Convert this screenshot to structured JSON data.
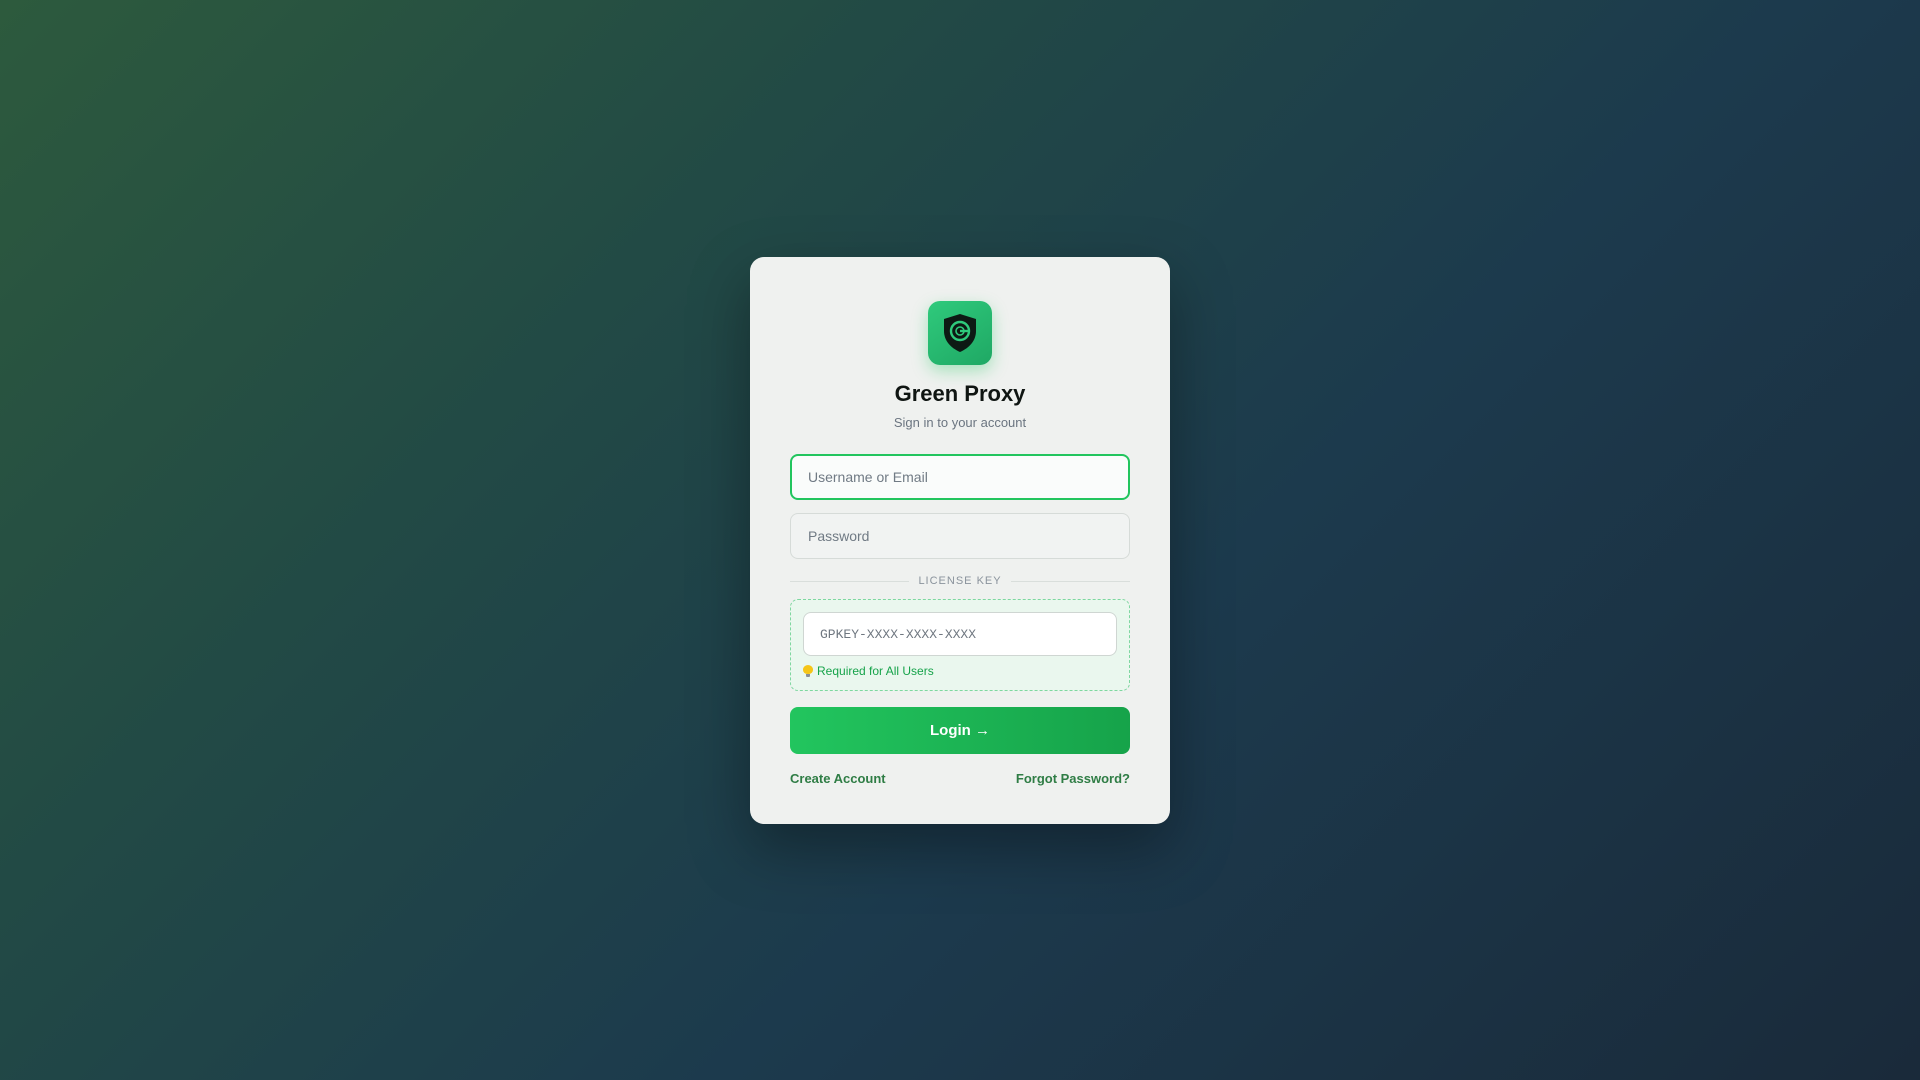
{
  "app": {
    "name": "Green Proxy",
    "subtitle": "Sign in to your account",
    "logo_icon": "shield-g-icon"
  },
  "form": {
    "username_placeholder": "Username or Email",
    "username_value": "",
    "password_placeholder": "Password",
    "password_value": "",
    "license_divider_label": "LICENSE KEY",
    "license_placeholder": "GPKEY-XXXX-XXXX-XXXX",
    "license_value": "",
    "license_note": "Required for All Users",
    "license_note_icon": "lightbulb-icon",
    "login_label": "Login →"
  },
  "links": {
    "create_account": "Create Account",
    "forgot_password": "Forgot Password?"
  },
  "colors": {
    "accent": "#22c55e",
    "accent_dark": "#16a34a",
    "link": "#2f7d45"
  }
}
